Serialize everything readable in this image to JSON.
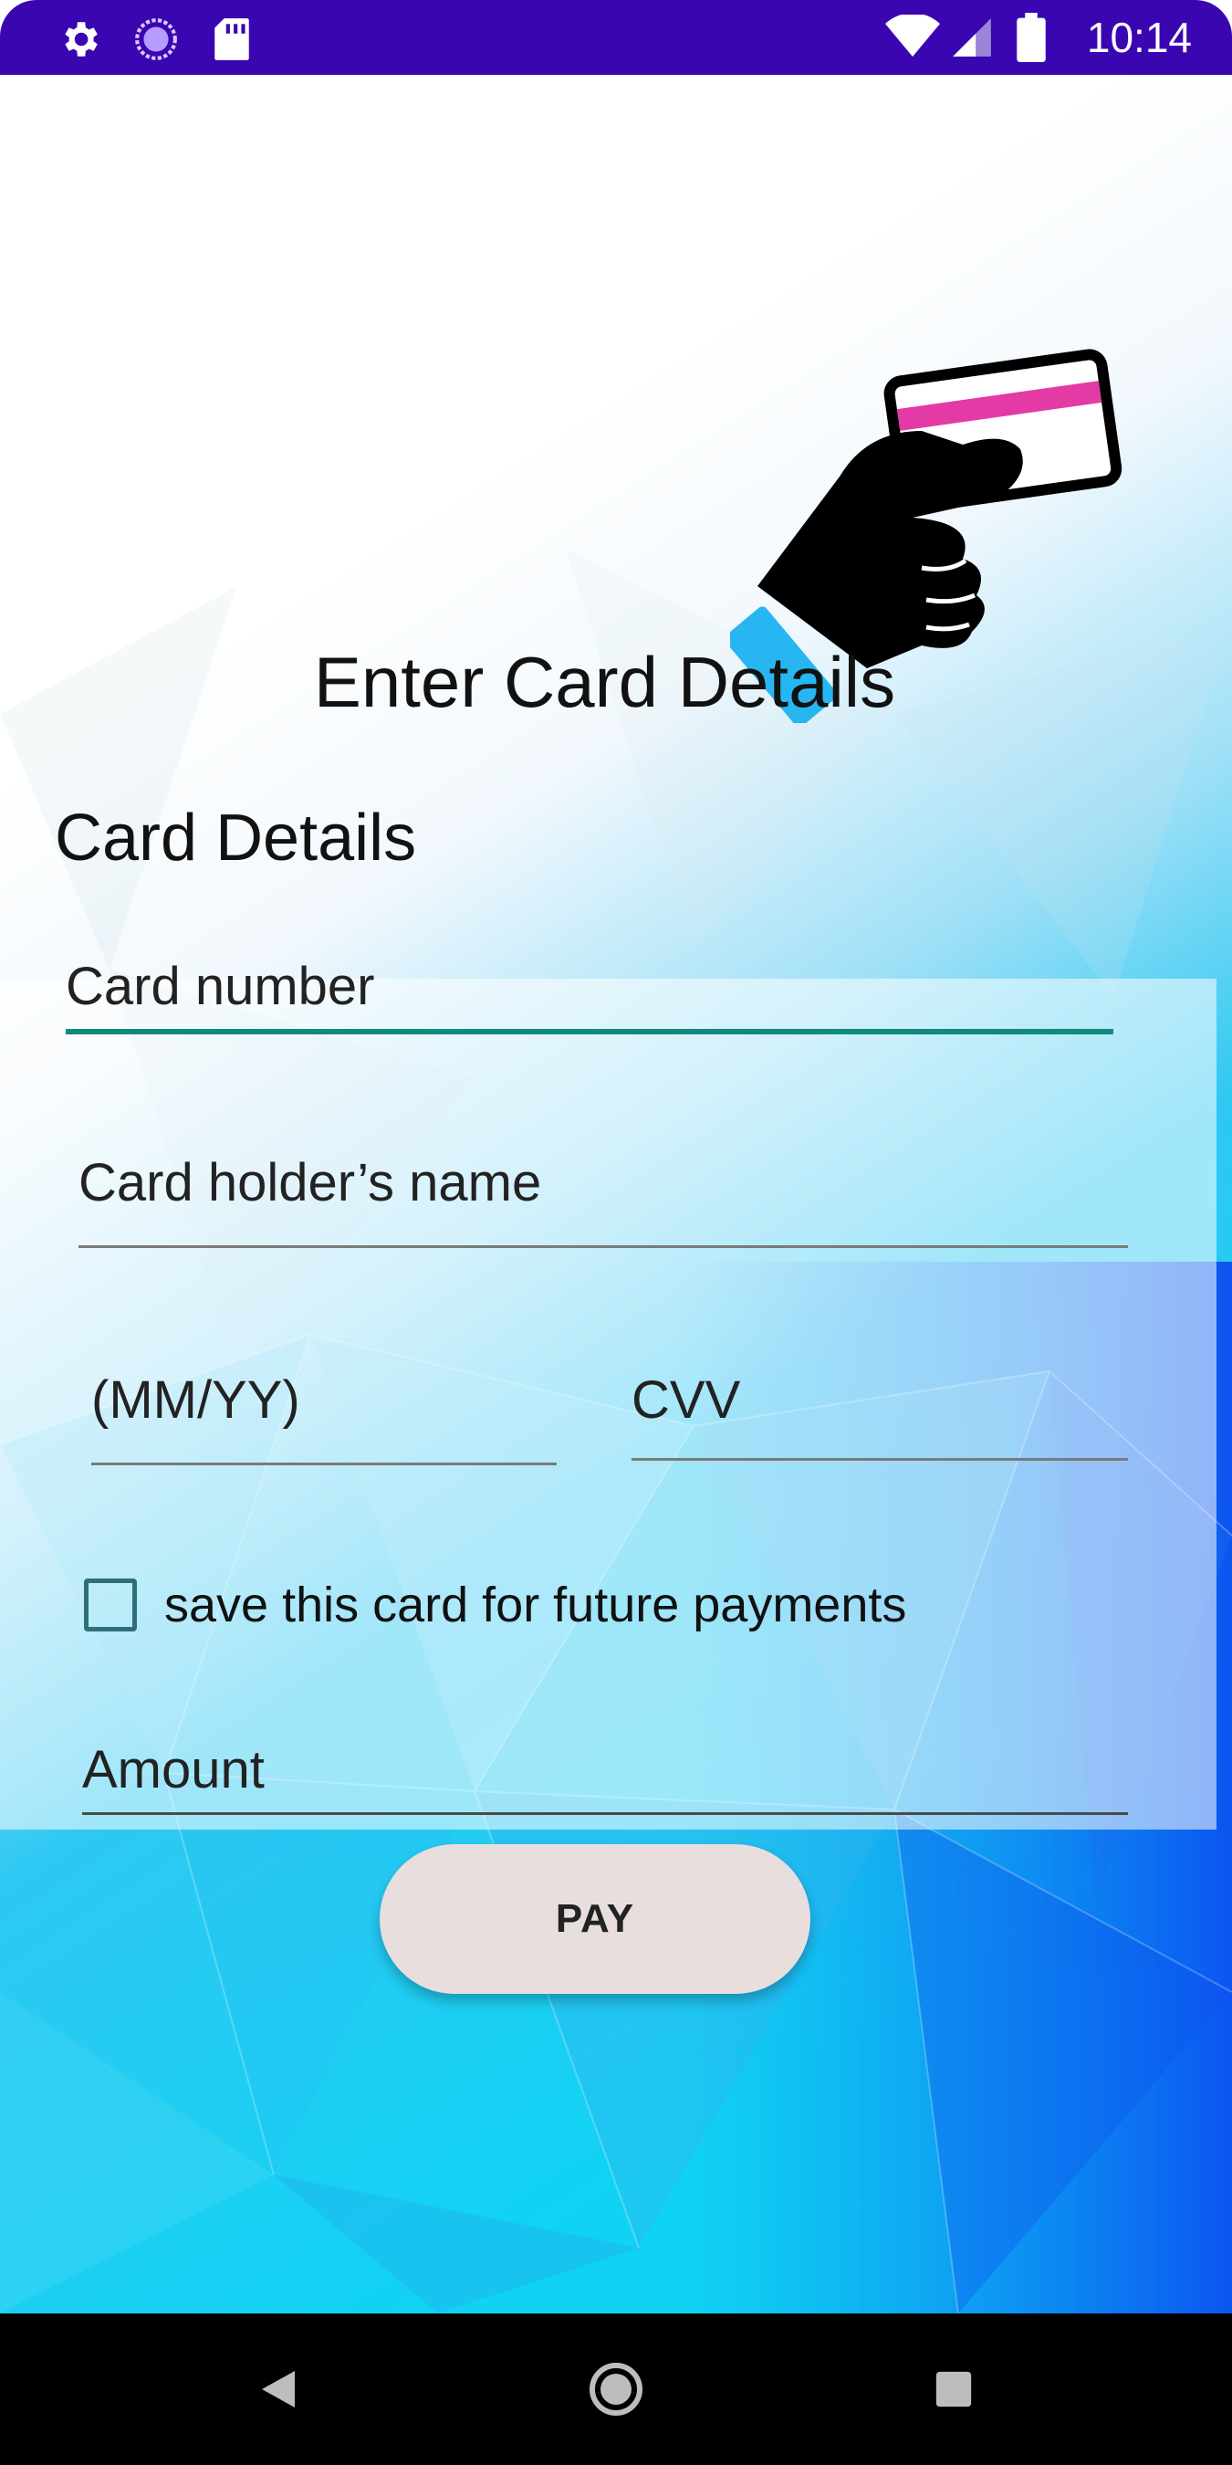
{
  "status_bar": {
    "time": "10:14",
    "left_icons": [
      "gear-icon",
      "sync-circle-icon",
      "sd-card-icon"
    ],
    "right_icons": [
      "wifi-icon",
      "signal-icon",
      "battery-icon"
    ],
    "background_color": "#3a06b2"
  },
  "header": {
    "title": "Enter Card Details",
    "illustration": "hand-holding-card-icon"
  },
  "form": {
    "section_title": "Card Details",
    "card_number_placeholder": "Card number",
    "card_holder_placeholder": "Card holder’s name",
    "expiry_placeholder": "(MM/YY)",
    "cvv_placeholder": "CVV",
    "save_card_label": "save this card for future payments",
    "save_card_checked": false,
    "amount_placeholder": "Amount",
    "focus_color": "#0f8a7c"
  },
  "actions": {
    "pay_label": "PAY"
  },
  "nav_bar": {
    "buttons": [
      "back-icon",
      "home-icon",
      "recents-icon"
    ]
  }
}
